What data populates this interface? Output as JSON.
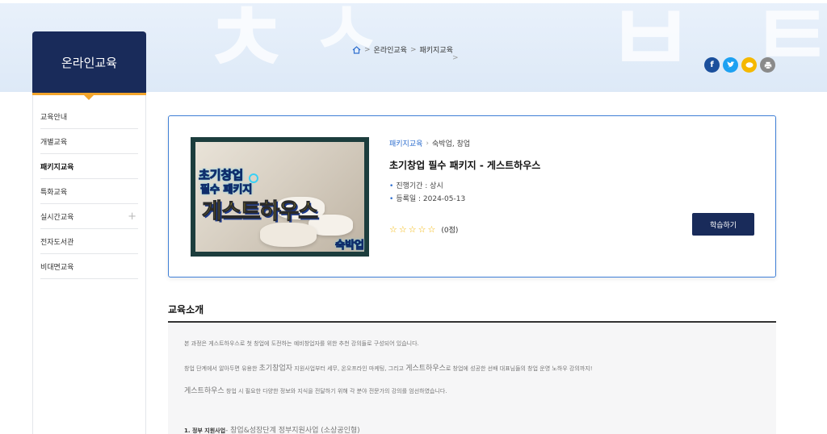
{
  "sidebar": {
    "title": "온라인교육",
    "items": [
      {
        "label": "교육안내",
        "active": false
      },
      {
        "label": "개별교육",
        "active": false
      },
      {
        "label": "패키지교육",
        "active": true
      },
      {
        "label": "특화교육",
        "active": false
      },
      {
        "label": "실시간교육",
        "active": false,
        "expandable": true
      },
      {
        "label": "전자도서관",
        "active": false
      },
      {
        "label": "비대면교육",
        "active": false
      }
    ],
    "plus_symbol": "+"
  },
  "breadcrumb": {
    "home_icon": "home-icon",
    "items": [
      "온라인교육",
      "패키지교육"
    ],
    "separator": ">"
  },
  "share": [
    {
      "icon": "facebook-icon",
      "glyph": "f",
      "color": "#1b4f9c"
    },
    {
      "icon": "twitter-icon",
      "glyph": "t",
      "color": "#1da1f2"
    },
    {
      "icon": "kakao-icon",
      "glyph": "●",
      "color": "#f5b800"
    },
    {
      "icon": "print-icon",
      "glyph": "⎙",
      "color": "#8a8a8a"
    }
  ],
  "course": {
    "thumbnail": {
      "line1": "초기창업",
      "line2": "필수 패키지",
      "line3": "게스트하우스",
      "badge": "숙박업"
    },
    "category": "패키지교육",
    "subcategory": "숙박업, 창업",
    "title": "초기창업 필수 패키지 - 게스트하우스",
    "period_label": "진행기간 : 상시",
    "date_label": "등록일 : 2024-05-13",
    "rating_stars": 0,
    "rating_max": 5,
    "rating_text": "(0점)",
    "button_label": "학습하기"
  },
  "intro": {
    "heading": "교육소개",
    "p1": "본 과정은 게스트하우스로 첫 창업에 도전하는 예비창업자를 위한 추천 강의들로 구성되어 있습니다.",
    "p2a": "창업 단계에서 알아두면 유용한 ",
    "p2b": "초기창업자",
    "p2c": " 지원사업부터 세무, 온오프라인 마케팅, 그리고 ",
    "p2d": "게스트하우스",
    "p2e": "로 창업에 성공한 선배 대표님들의 창업 운영 노하우 강의까지!",
    "p3a": "게스트하우스",
    "p3b": " 창업 시 필요한 다양한 정보와 지식을 전달하기 위해 각 분야 전문가의 강의를 엄선하였습니다.",
    "p4a": "1. 정부 지원사업",
    "p4b": "- 창업&성장단계 정부지원사업 (소상공인형)"
  },
  "colors": {
    "navy": "#192b5a",
    "accent_blue": "#3f7fd6",
    "orange": "#f3a52b"
  }
}
